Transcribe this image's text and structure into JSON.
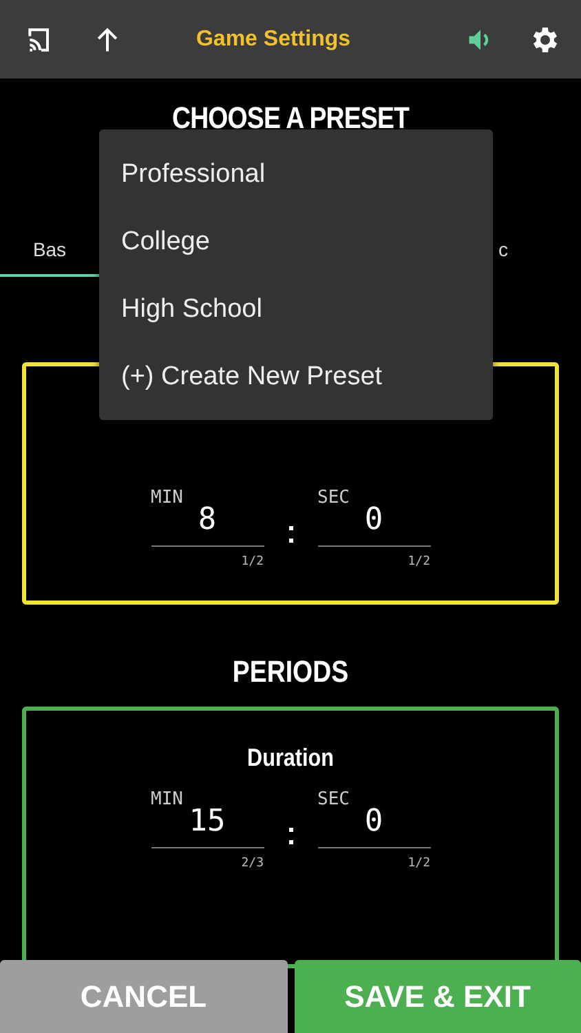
{
  "top_bar": {
    "title": "Game Settings",
    "sound_on": true
  },
  "preset_heading": "CHOOSE A PRESET",
  "tabs": [
    {
      "label": "Bas",
      "selected": true
    },
    {
      "label": "c",
      "selected": false
    }
  ],
  "sections": [
    {
      "color": "#f2e33a",
      "min_label": "MIN",
      "min_value": "8",
      "min_count": "1/2",
      "sec_label": "SEC",
      "sec_value": "0",
      "sec_count": "1/2"
    },
    {
      "heading": "PERIODS",
      "color": "#4caf50",
      "label": "Duration",
      "min_label": "MIN",
      "min_value": "15",
      "min_count": "2/3",
      "sec_label": "SEC",
      "sec_value": "0",
      "sec_count": "1/2"
    }
  ],
  "menu": {
    "items": [
      "Professional",
      "College",
      "High School",
      "(+) Create New Preset"
    ]
  },
  "buttons": [
    {
      "label": "CANCEL",
      "kind": "cancel"
    },
    {
      "label": "SAVE & EXIT",
      "kind": "save"
    }
  ]
}
